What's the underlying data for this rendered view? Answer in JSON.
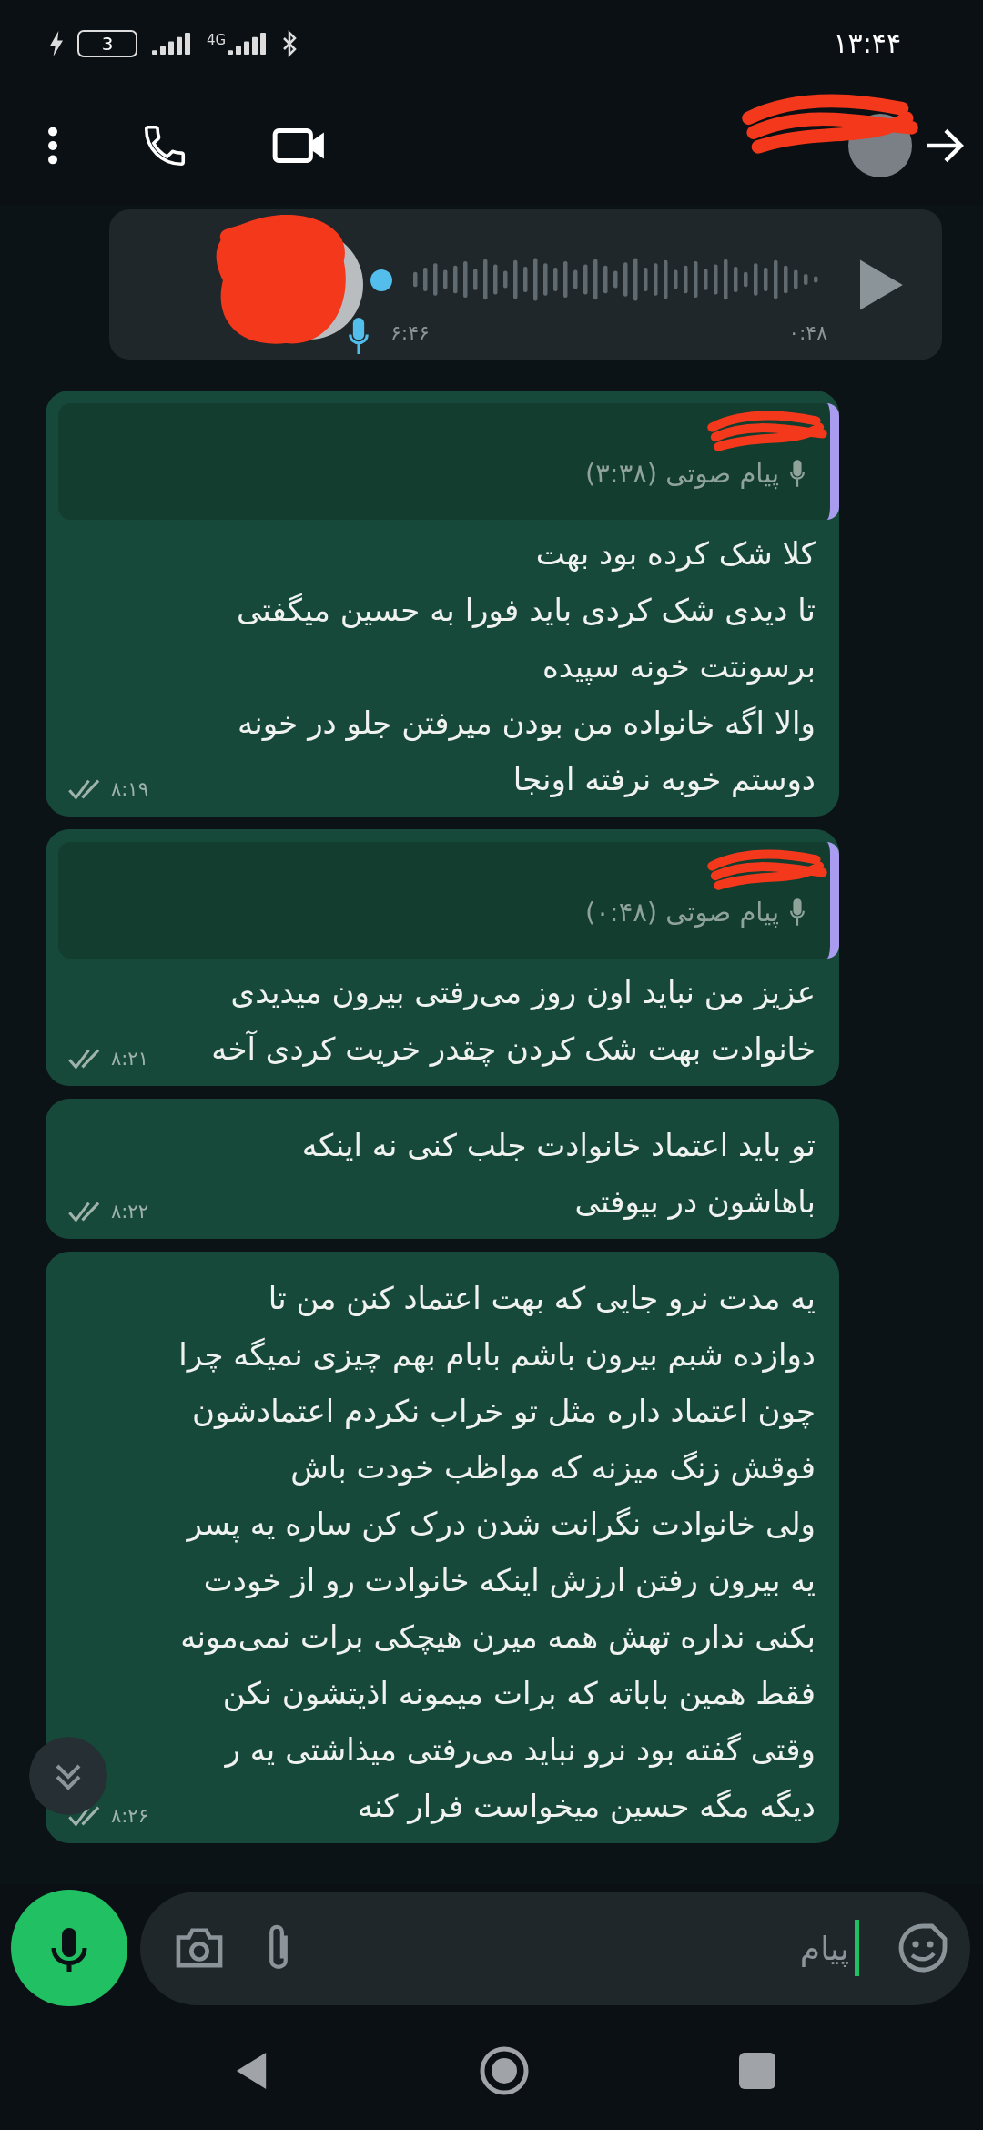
{
  "status_bar": {
    "time": "۱۳:۴۴",
    "battery": "3",
    "network": "4G",
    "charging": true
  },
  "header": {
    "redacted": true
  },
  "messages": [
    {
      "kind": "voice",
      "redacted": true,
      "duration": "۰:۴۸",
      "time": "۶:۴۶"
    },
    {
      "kind": "text",
      "quote": {
        "redacted": true,
        "label": "پیام صوتی (۳:۳۸)"
      },
      "text": "کلا شک کرده بود بهت\nتا دیدی شک کردی باید فورا به حسین میگفتی\nبرسونتت خونه سپیده\nوالا اگه خانواده من بودن میرفتن جلو در خونه\nدوستم خوبه نرفته اونجا",
      "time": "۸:۱۹",
      "read": false
    },
    {
      "kind": "text",
      "quote": {
        "redacted": true,
        "label": "پیام صوتی (۰:۴۸)"
      },
      "text": "عزیز من نباید اون روز می‌رفتی بیرون میدیدی\nخانوادت بهت شک کردن چقدر خریت کردی آخه",
      "time": "۸:۲۱",
      "read": false
    },
    {
      "kind": "text",
      "text": "تو باید اعتماد خانوادت جلب کنی نه اینکه\nباهاشون در بیوفتی",
      "time": "۸:۲۲",
      "read": false
    },
    {
      "kind": "text",
      "text": "یه مدت نرو جایی که بهت اعتماد کنن من تا\nدوازده شبم بیرون باشم بابام بهم چیزی نمیگه چرا\nچون اعتماد داره مثل تو خراب نکردم اعتمادشون\nفوقش زنگ میزنه که مواظب خودت باش\nولی خانوادت نگرانت شدن درک کن ساره یه پسر\nیه بیرون رفتن ارزش اینکه خانوادت رو از خودت\nبکنی نداره تهش همه میرن هیچکی برات نمی‌مونه\nفقط همین باباته که برات میمونه اذیتشون نکن\nوقتی گفته بود نرو نباید می‌رفتی میذاشتی یه ر\nدیگه مگه حسین میخواست فرار کنه",
      "time": "۸:۲۶",
      "read": false
    }
  ],
  "composer": {
    "placeholder": "پیام"
  }
}
